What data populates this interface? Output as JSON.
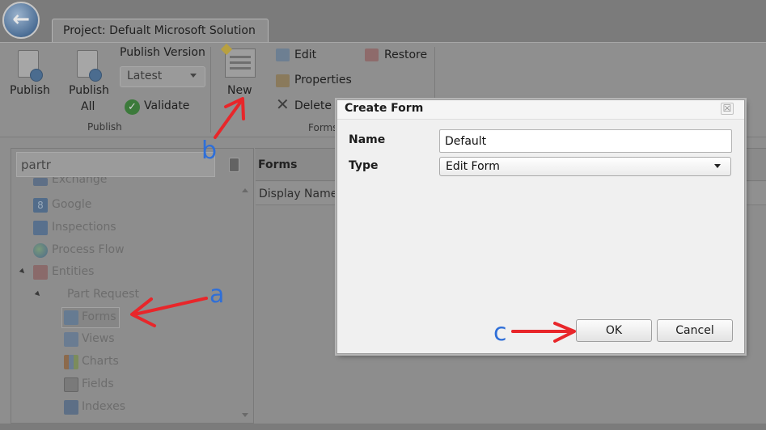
{
  "window": {
    "back_icon": "back-arrow-icon",
    "project_tab": "Project: Defualt Microsoft Solution"
  },
  "ribbon": {
    "publish": "Publish",
    "publish_all_line1": "Publish",
    "publish_all_line2": "All",
    "publish_version": "Publish Version",
    "version_selected": "Latest",
    "validate": "Validate",
    "group_publish": "Publish",
    "new": "New",
    "edit": "Edit",
    "properties": "Properties",
    "delete": "Delete",
    "restore": "Restore",
    "group_forms": "Forms"
  },
  "tree": {
    "search_value": "partr",
    "items": [
      {
        "label": "Exchange",
        "icon": "exchange-icon"
      },
      {
        "label": "Google",
        "icon": "google-icon"
      },
      {
        "label": "Inspections",
        "icon": "inspections-icon"
      },
      {
        "label": "Process Flow",
        "icon": "globe-icon"
      },
      {
        "label": "Entities",
        "icon": "entities-icon"
      },
      {
        "label": "Part Request",
        "icon": ""
      },
      {
        "label": "Forms",
        "icon": "forms-icon"
      },
      {
        "label": "Views",
        "icon": "views-icon"
      },
      {
        "label": "Charts",
        "icon": "charts-icon"
      },
      {
        "label": "Fields",
        "icon": "fields-icon"
      },
      {
        "label": "Indexes",
        "icon": "indexes-icon"
      }
    ]
  },
  "main": {
    "header": "Forms",
    "column_display_name": "Display Name"
  },
  "dialog": {
    "title": "Create Form",
    "close_glyph": "☒",
    "name_label": "Name",
    "name_value": "Default",
    "type_label": "Type",
    "type_selected": "Edit Form",
    "ok": "OK",
    "cancel": "Cancel"
  },
  "annotations": {
    "a": "a",
    "b": "b",
    "c": "c",
    "arrow_color": "#e8262a",
    "letter_color": "#2f6fd8"
  }
}
